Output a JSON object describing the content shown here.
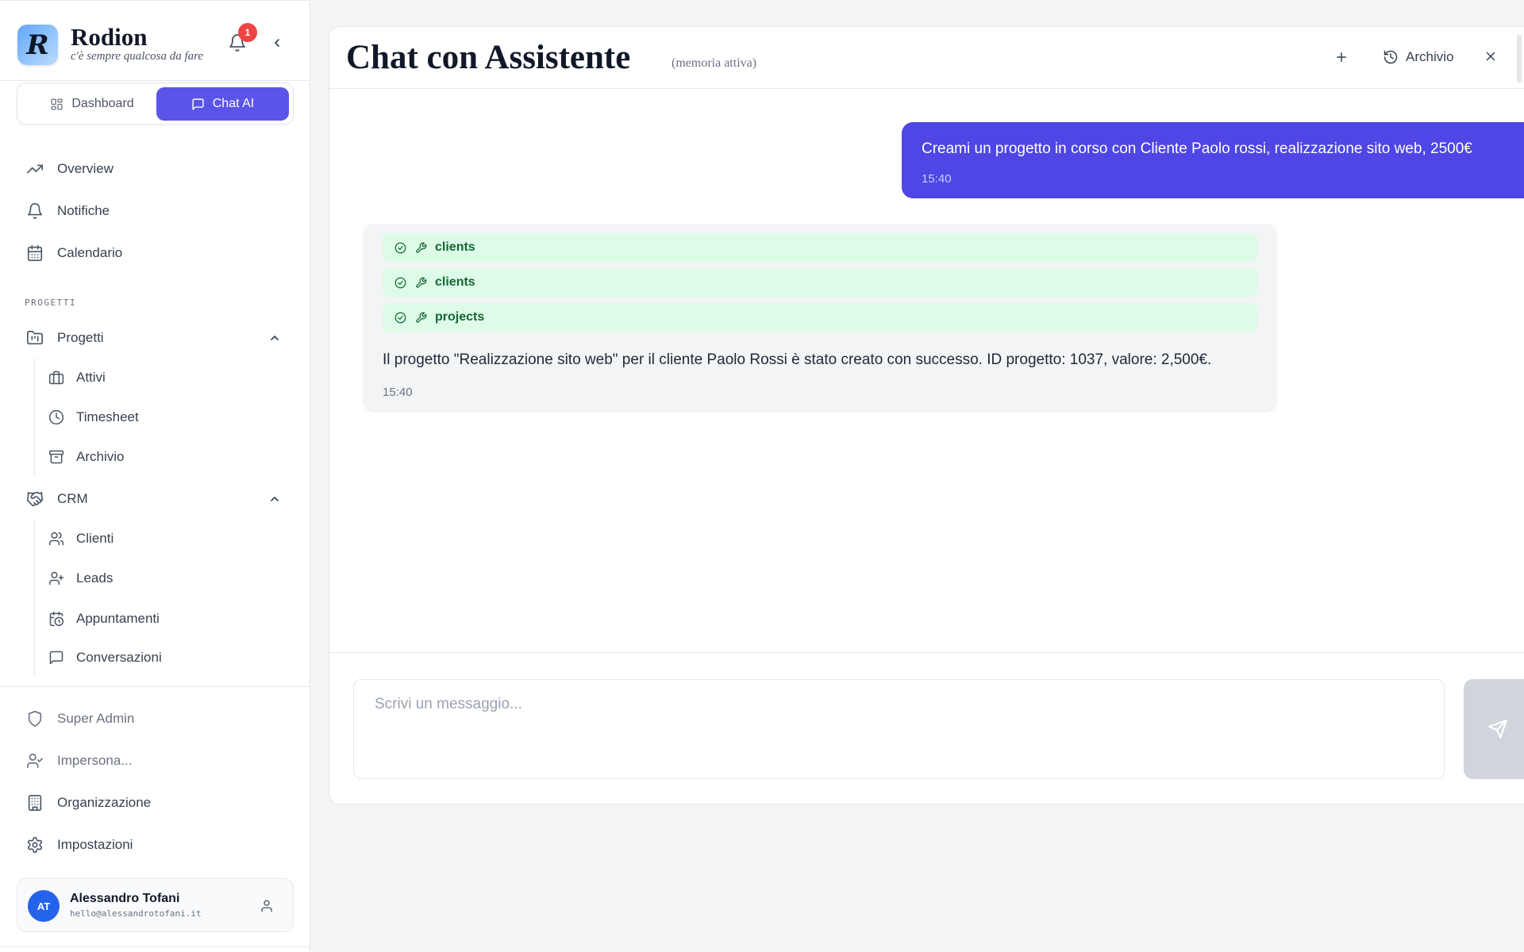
{
  "brand": {
    "name": "Rodion",
    "tagline": "c'è sempre qualcosa da fare",
    "logo_letter": "R",
    "notification_count": "1"
  },
  "switcher": {
    "dashboard_label": "Dashboard",
    "chat_label": "Chat AI"
  },
  "nav": {
    "overview": "Overview",
    "notifiche": "Notifiche",
    "calendario": "Calendario",
    "section_progetti": "PROGETTI",
    "progetti": "Progetti",
    "attivi": "Attivi",
    "timesheet": "Timesheet",
    "archivio": "Archivio",
    "crm": "CRM",
    "clienti": "Clienti",
    "leads": "Leads",
    "appuntamenti": "Appuntamenti",
    "conversazioni": "Conversazioni",
    "super_admin": "Super Admin",
    "impersona": "Impersona...",
    "organizzazione": "Organizzazione",
    "impostazioni": "Impostazioni"
  },
  "user": {
    "initials": "AT",
    "name": "Alessandro Tofani",
    "email": "hello@alessandrotofani.it"
  },
  "chat": {
    "title": "Chat con Assistente",
    "subtitle": "(memoria attiva)",
    "archive_label": "Archivio",
    "messages": [
      {
        "role": "user",
        "text": "Creami un progetto in corso con Cliente Paolo rossi, realizzazione sito web, 2500€",
        "time": "15:40"
      },
      {
        "role": "assistant",
        "tools": [
          "clients",
          "clients",
          "projects"
        ],
        "text": "Il progetto \"Realizzazione sito web\" per il cliente Paolo Rossi è stato creato con successo. ID progetto: 1037, valore: 2,500€.",
        "time": "15:40"
      }
    ],
    "input_placeholder": "Scrivi un messaggio...",
    "input_value": ""
  },
  "colors": {
    "accent": "#5b54e8",
    "user_bubble": "#4f46e5",
    "tool_chip_bg": "#dcfce7",
    "tool_chip_text": "#166534",
    "badge": "#ef4444"
  },
  "icons": {
    "nav": [
      "trending-up-icon",
      "bell-icon",
      "calendar-icon",
      "folder-icon",
      "briefcase-icon",
      "clock-icon",
      "archive-box-icon",
      "handshake-icon",
      "users-icon",
      "user-plus-icon",
      "calendar-clock-icon",
      "message-square-icon",
      "shield-icon",
      "user-check-icon",
      "building-icon",
      "gear-icon"
    ],
    "tool_chip": [
      "check-circle-icon",
      "wrench-icon"
    ],
    "header": [
      "plus-icon",
      "history-icon",
      "close-icon"
    ],
    "send": "send-icon"
  }
}
